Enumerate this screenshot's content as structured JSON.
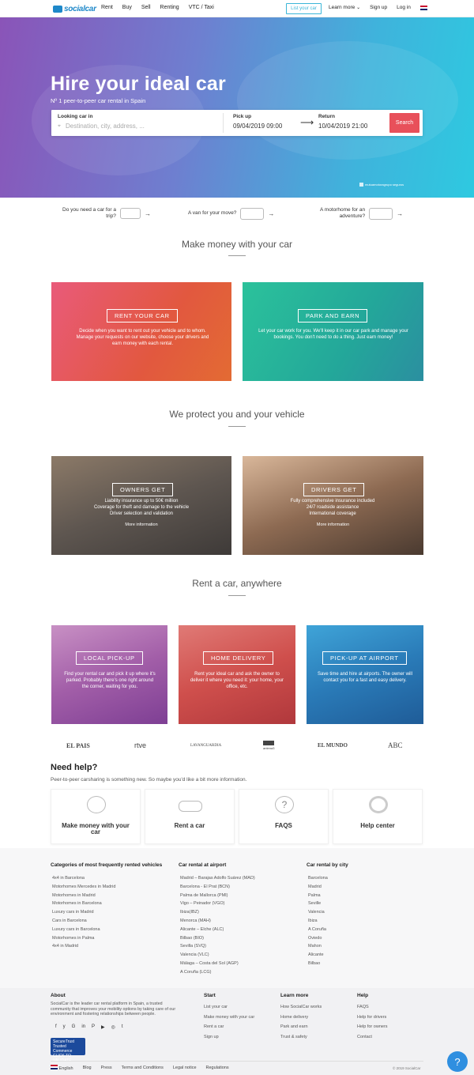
{
  "nav": {
    "logo": "socialcar",
    "links": [
      "Rent",
      "Buy",
      "Sell",
      "Renting",
      "VTC / Taxi"
    ],
    "list_car": "List your car",
    "learn_more": "Learn more",
    "sign_up": "Sign up",
    "log_in": "Log in"
  },
  "hero": {
    "title": "Hire your ideal car",
    "subtitle": "Nº 1 peer-to-peer car rental in Spain",
    "search": {
      "looking_label": "Looking car in",
      "looking_placeholder": "Destination, city, address, ...",
      "pickup_label": "Pick up",
      "pickup_value": "09/04/2019  09:00",
      "return_label": "Return",
      "return_value": "10/04/2019  21:00",
      "button": "Search"
    },
    "insurance": "mutuamotoragrupo seguros"
  },
  "vehicles": [
    {
      "line1": "Do you need a car for a",
      "line2": "trip?"
    },
    {
      "line1": "A van for your move?",
      "line2": ""
    },
    {
      "line1": "A motorhome for an",
      "line2": "adventure?"
    }
  ],
  "sections": {
    "money": "Make money with your car",
    "protect": "We protect you and your vehicle",
    "anywhere": "Rent a car, anywhere"
  },
  "money_cards": [
    {
      "label": "RENT YOUR CAR",
      "desc": "Decide when you want to rent out your vehicle and to whom. Manage your requests on our website, choose your drivers and earn money with each rental."
    },
    {
      "label": "PARK AND EARN",
      "desc": "Let your car work for you. We'll keep it in our car park and manage your bookings. You don't need to do a thing. Just earn money!"
    }
  ],
  "protect_cards": [
    {
      "label": "OWNERS GET",
      "lines": [
        "Liability insurance up to 50€ million",
        "Coverage for theft and damage to the vehicle",
        "Driver selection and validation"
      ],
      "more": "More information"
    },
    {
      "label": "DRIVERS GET",
      "lines": [
        "Fully comprehensive insurance included",
        "24/7 roadside assistance",
        "International coverage"
      ],
      "more": "More information"
    }
  ],
  "anywhere_cards": [
    {
      "label": "LOCAL PICK-UP",
      "desc": "Find your rental car and pick it up where it's parked. Probably there's one right around the corner, waiting for you."
    },
    {
      "label": "HOME DELIVERY",
      "desc": "Rent your ideal car and ask the owner to deliver it where you need it: your home, your office, etc."
    },
    {
      "label": "PICK-UP AT AIRPORT",
      "desc": "Save time and hire at airports. The owner will contact you for a fast and easy delivery."
    }
  ],
  "press": [
    "EL PAIS",
    "rtve",
    "LAVANGUARDIA",
    "antena3",
    "EL MUNDO",
    "ABC"
  ],
  "help": {
    "title": "Need help?",
    "subtitle": "Peer-to-peer carsharing is something new. So maybe you'd like a bit more information.",
    "cards": [
      "Make money with your car",
      "Rent a car",
      "FAQS",
      "Help center"
    ]
  },
  "categories": {
    "col1": {
      "title": "Categories of most frequently rented vehicles",
      "items": [
        "4x4 in Barcelona",
        "Motorhomes Mercedes in Madrid",
        "Motorhomes in Madrid",
        "Motorhomes in Barcelona",
        "Luxury cars in Madrid",
        "Cars in Barcelona",
        "Luxury cars in Barcelona",
        "Motorhomes in Palma",
        "4x4 in Madrid"
      ]
    },
    "col2": {
      "title": "Car rental at airport",
      "items": [
        "Madrid – Barajas Adolfo Suárez (MAD)",
        "Barcelona - El Prat (BCN)",
        "Palma de Mallorca (PMI)",
        "Vigo – Peinador (VGO)",
        "Ibiza(IBZ)",
        "Menorca (MAH)",
        "Alicante – Elche (ALC)",
        "Bilbao (BIO)",
        "Sevilla (SVQ)",
        "Valencia (VLC)",
        "Málaga – Costa del Sol (AGP)",
        "A Coruña (LCG)"
      ]
    },
    "col3": {
      "title": "Car rental by city",
      "items": [
        "Barcelona",
        "Madrid",
        "Palma",
        "Seville",
        "Valencia",
        "Ibiza",
        "A Coruña",
        "Oviedo",
        "Mahon",
        "Alicante",
        "Bilbao"
      ]
    }
  },
  "footer": {
    "about_title": "About",
    "about_text": "SocialCar is the leader car rental platform in Spain, a trusted community that improves your mobility options by taking care of our environment and fostering relationships between people.",
    "social": [
      "f",
      "y",
      "G",
      "in",
      "P",
      "▶",
      "◎",
      "t"
    ],
    "trust": "SecureTrust Trusted Commerce CLICK TO VALIDATE",
    "start": {
      "title": "Start",
      "items": [
        "List your car",
        "Make money with your car",
        "Rent a car",
        "Sign up"
      ]
    },
    "learn": {
      "title": "Learn more",
      "items": [
        "How SocialCar works",
        "Home delivery",
        "Park and earn",
        "Trust & safety"
      ]
    },
    "helpcol": {
      "title": "Help",
      "items": [
        "FAQS",
        "Help for drivers",
        "Help for owners",
        "Contact"
      ]
    },
    "bottom": [
      "English",
      "Blog",
      "Press",
      "Terms and Conditions",
      "Legal notice",
      "Regulations"
    ],
    "copyright": "© 2019 SocialCar"
  },
  "help_button": "?"
}
